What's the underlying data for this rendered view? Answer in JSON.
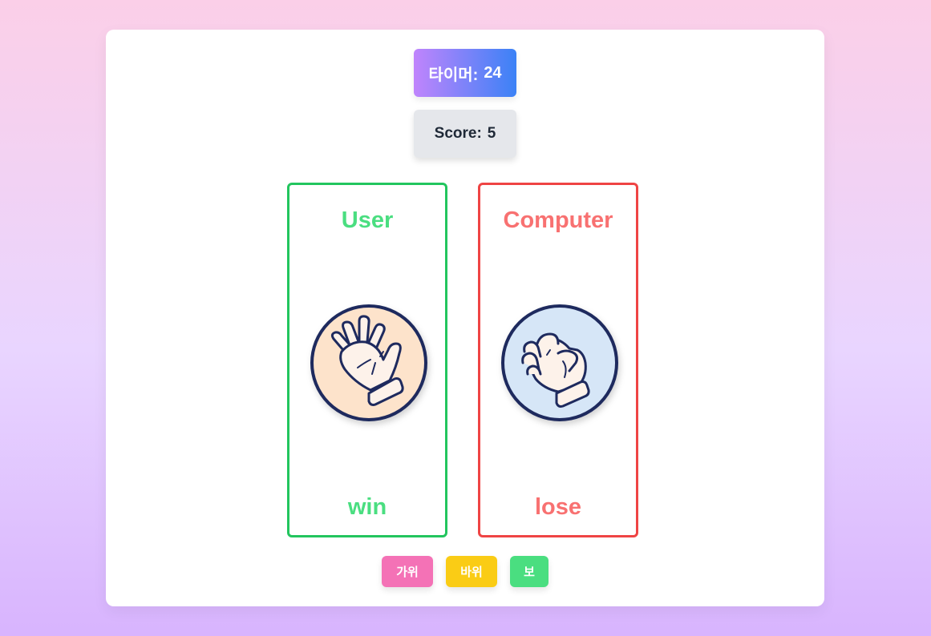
{
  "timer": {
    "label": "타이머:",
    "value": "24"
  },
  "score": {
    "label": "Score:",
    "value": "5"
  },
  "user": {
    "title": "User",
    "hand_icon": "paper-hand-icon",
    "result": "win"
  },
  "computer": {
    "title": "Computer",
    "hand_icon": "rock-fist-icon",
    "result": "lose"
  },
  "buttons": {
    "scissors": "가위",
    "rock": "바위",
    "paper": "보"
  },
  "colors": {
    "win": "#22c55e",
    "lose": "#ef4444",
    "scissors_button": "#f472b6",
    "rock_button": "#facc15",
    "paper_button": "#4ade80"
  }
}
